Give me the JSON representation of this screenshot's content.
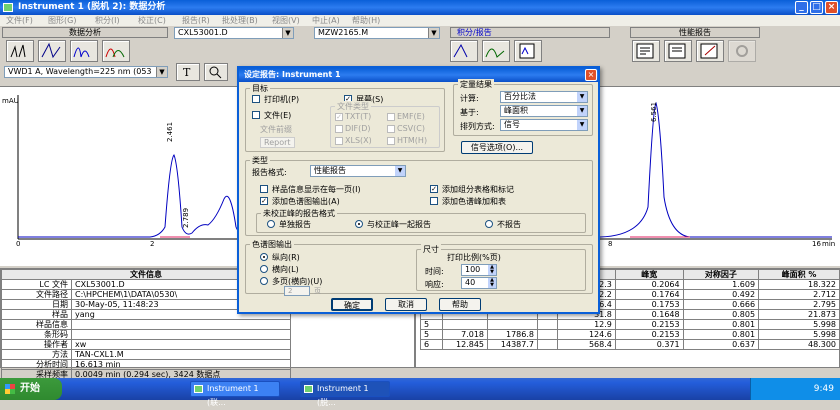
{
  "window": {
    "title": "Instrument 1 (脱机 2): 数据分析"
  },
  "menu": [
    "文件(F)",
    "图形(G)",
    "积分(I)",
    "校正(C)",
    "报告(R)",
    "批处理(B)",
    "视图(V)",
    "中止(A)",
    "帮助(H)"
  ],
  "toolbar": {
    "left_section": "数据分析",
    "data_file": "CXL53001.D",
    "method": "MZW2165.M",
    "integ_section": "积分/报告",
    "perf_section": "性能报告",
    "signal_select": "VWD1 A, Wavelength=225 nm (053"
  },
  "chromatogram": {
    "title": "VWD1 A, Wavelength=225 nm (0530\\CXL53001.D)",
    "y_unit": "mAU",
    "peak_labels": [
      "2.461",
      "2.789",
      "6.561"
    ],
    "x_ticks": [
      "0",
      "2",
      "4",
      "6",
      "8",
      "10",
      "12",
      "14",
      "16"
    ],
    "x_unit": "min"
  },
  "fileinfo": {
    "header": "文件信息",
    "rows": [
      [
        "LC 文件",
        "CXL53001.D"
      ],
      [
        "文件路径",
        "C:\\HPCHEM\\1\\DATA\\0530\\"
      ],
      [
        "日期",
        "30-May-05, 11:48:23"
      ],
      [
        "样品",
        "yang"
      ],
      [
        "样品信息",
        ""
      ],
      [
        "条形码",
        ""
      ],
      [
        "操作者",
        "xw"
      ],
      [
        "方法",
        "TAN-CXL1.M"
      ],
      [
        "分析时间",
        "16.613 min"
      ],
      [
        "采样频率",
        "0.0049 min (0.294 sec), 3424 数据点"
      ]
    ]
  },
  "results": {
    "headers": [
      "",
      "",
      "",
      "",
      "峰高",
      "峰宽",
      "对称因子",
      "峰面积 %"
    ],
    "rows": [
      [
        "",
        "",
        "",
        "",
        "42.3",
        "0.2064",
        "1.609",
        "18.322"
      ],
      [
        "",
        "",
        "",
        "",
        "2.2",
        "0.1764",
        "0.492",
        "2.712"
      ],
      [
        "",
        "",
        "",
        "",
        "26.4",
        "0.1753",
        "0.666",
        "2.795"
      ],
      [
        "",
        "",
        "",
        "",
        "31.8",
        "0.1648",
        "0.805",
        "21.873"
      ],
      [
        "5",
        "",
        "",
        "",
        "12.9",
        "0.2153",
        "0.801",
        "5.998"
      ],
      [
        "5",
        "7.018",
        "1786.8",
        "",
        "124.6",
        "0.2153",
        "0.801",
        "5.998"
      ],
      [
        "6",
        "12.845",
        "14387.7",
        "",
        "568.4",
        "0.371",
        "0.637",
        "48.300"
      ]
    ]
  },
  "dialog": {
    "title": "设定报告: Instrument 1",
    "target_group": "目标",
    "printer": "打印机(P)",
    "screen": "屏幕(S)",
    "file": "文件(E)",
    "file_types": "文件类型",
    "ft": [
      "TXT(T)",
      "EMF(E)",
      "DIF(D)",
      "CSV(C)",
      "XLS(X)",
      "HTM(H)"
    ],
    "file_prefix": "文件前缀",
    "prefix_value": "Report",
    "quant_group": "定量结果",
    "calc_label": "计算:",
    "calc_value": "百分比法",
    "base_label": "基于:",
    "base_value": "峰面积",
    "sort_label": "排列方式:",
    "sort_value": "信号",
    "signal_options": "信号选项(O)...",
    "type_group": "类型",
    "format_label": "报告格式:",
    "format_value": "性能报告",
    "opt1": "样品信息显示在每一页(I)",
    "opt2": "添加色谱图输出(A)",
    "opt3": "添加组分表格和标记",
    "opt4": "添加色谱峰加和表",
    "uncal_group": "未校正峰的报告格式",
    "uncal": [
      "单独报告",
      "与校正峰一起报告",
      "不报告"
    ],
    "chrom_group": "色谱图输出",
    "portrait": "纵向(R)",
    "landscape": "横向(L)",
    "multipage": "多页(横向)(U)",
    "pages_value": "2",
    "pages_unit": "页",
    "size_group": "尺寸",
    "print_scale": "打印比例(%页)",
    "time_label": "时间:",
    "time_value": "100",
    "resp_label": "响应:",
    "resp_value": "40",
    "ok": "确定",
    "cancel": "取消",
    "help": "帮助"
  },
  "taskbar": {
    "start": "开始",
    "tasks": [
      "Instrument 1 (联...",
      "Instrument 1 (脱..."
    ],
    "clock": "9:49"
  }
}
